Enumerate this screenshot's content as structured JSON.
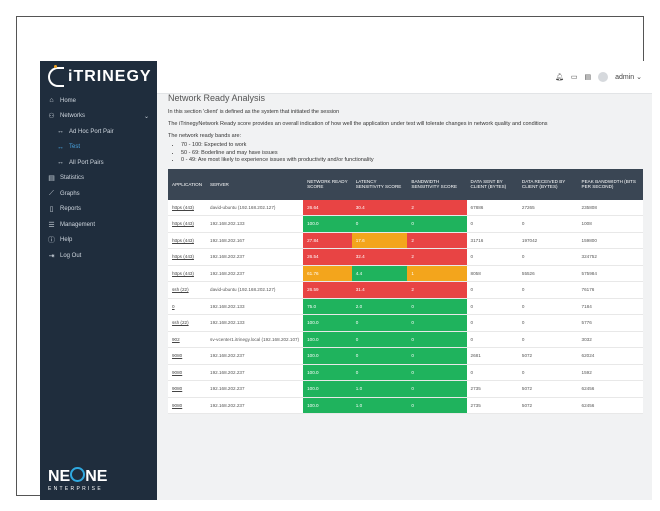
{
  "brand": {
    "logo_text": "iTRINEGY",
    "footer_big": "NE ONE",
    "footer_big_a": "NE",
    "footer_big_b": "NE",
    "footer_small": "ENTERPRISE"
  },
  "colors": {
    "sidebar": "#1f2d3d",
    "header": "#3a4654",
    "red": "#e84444",
    "green": "#1fb35d",
    "orange": "#f3a51c",
    "active": "#4aa3df"
  },
  "nav": [
    {
      "label": "Home",
      "icon": "home-icon",
      "glyph": "⌂"
    },
    {
      "label": "Networks",
      "icon": "networks-icon",
      "glyph": "⚇",
      "chevron": "⌄"
    },
    {
      "label": "Ad Hoc Port Pair",
      "icon": "arrows-icon",
      "glyph": "↔",
      "sub": true
    },
    {
      "label": "Test",
      "icon": "arrows-icon",
      "glyph": "↔",
      "sub": true,
      "active": true
    },
    {
      "label": "All Port Pairs",
      "icon": "arrows-icon",
      "glyph": "↔",
      "sub": true
    },
    {
      "label": "Statistics",
      "icon": "statistics-icon",
      "glyph": "▤"
    },
    {
      "label": "Graphs",
      "icon": "graphs-icon",
      "glyph": "⟋"
    },
    {
      "label": "Reports",
      "icon": "reports-icon",
      "glyph": "▯"
    },
    {
      "label": "Management",
      "icon": "management-icon",
      "glyph": "☰"
    },
    {
      "label": "Help",
      "icon": "help-icon",
      "glyph": "ⓘ"
    },
    {
      "label": "Log Out",
      "icon": "logout-icon",
      "glyph": "⇥"
    }
  ],
  "topbar": {
    "user": "admin",
    "chevron": "⌄"
  },
  "page": {
    "title": "Network Ready Analysis",
    "p1": "In this section 'client' is defined as the system that initiated the session",
    "p2": "The iTrinegyNetwork Ready score provides an overall indication of how well the application under test will tolerate changes in network quality and conditions",
    "p3": "The network ready bands are:",
    "bands": [
      "70 - 100: Expected to work",
      "50 - 69: Boderline and may have issues",
      "0 - 49: Are most likely to experience issues with productivity and/or functionality"
    ]
  },
  "table": {
    "headers": [
      "APPLICATION",
      "SERVER",
      "NETWORK READY SCORE",
      "LATENCY SENSITIVITY SCORE",
      "BANDWIDTH SENSITIVITY SCORE",
      "DATA SENT BY CLIENT (BYTES)",
      "DATA RECEIVED BY CLIENT (BYTES)",
      "PEAK BANDWIDTH (BITS PER SECOND)"
    ],
    "rows": [
      {
        "app": "https (443)",
        "server": "david-ubuntu (192.168.202.127)",
        "nrs": "26.64",
        "nrs_c": "red",
        "lat": "30.4",
        "lat_c": "red",
        "bw": "2",
        "bw_c": "red",
        "sent": "67886",
        "recv": "27265",
        "peak": "235808"
      },
      {
        "app": "https (443)",
        "server": "192.168.202.133",
        "nrs": "100.0",
        "nrs_c": "green",
        "lat": "0",
        "lat_c": "green",
        "bw": "0",
        "bw_c": "green",
        "sent": "0",
        "recv": "0",
        "peak": "1008"
      },
      {
        "app": "https (443)",
        "server": "192.168.202.167",
        "nrs": "27.84",
        "nrs_c": "red",
        "lat": "17.6",
        "lat_c": "orange",
        "bw": "2",
        "bw_c": "red",
        "sent": "31716",
        "recv": "197042",
        "peak": "159800"
      },
      {
        "app": "https (443)",
        "server": "192.168.202.237",
        "nrs": "26.54",
        "nrs_c": "red",
        "lat": "32.4",
        "lat_c": "red",
        "bw": "2",
        "bw_c": "red",
        "sent": "0",
        "recv": "0",
        "peak": "324752"
      },
      {
        "app": "https (443)",
        "server": "192.168.202.237",
        "nrs": "61.76",
        "nrs_c": "orange",
        "lat": "4.4",
        "lat_c": "green",
        "bw": "1",
        "bw_c": "orange",
        "sent": "8058",
        "recv": "55526",
        "peak": "575984"
      },
      {
        "app": "ssh (22)",
        "server": "david-ubuntu (192.168.202.127)",
        "nrs": "26.59",
        "nrs_c": "red",
        "lat": "31.4",
        "lat_c": "red",
        "bw": "2",
        "bw_c": "red",
        "sent": "0",
        "recv": "0",
        "peak": "76176"
      },
      {
        "app": "0",
        "server": "192.168.202.133",
        "nrs": "75.0",
        "nrs_c": "green",
        "lat": "2.0",
        "lat_c": "green",
        "bw": "0",
        "bw_c": "green",
        "sent": "0",
        "recv": "0",
        "peak": "7184"
      },
      {
        "app": "ssh (22)",
        "server": "192.168.202.133",
        "nrs": "100.0",
        "nrs_c": "green",
        "lat": "0",
        "lat_c": "green",
        "bw": "0",
        "bw_c": "green",
        "sent": "0",
        "recv": "0",
        "peak": "5776"
      },
      {
        "app": "902",
        "server": "sv-vcenter1.itrinegy.local (192.168.202.107)",
        "nrs": "100.0",
        "nrs_c": "green",
        "lat": "0",
        "lat_c": "green",
        "bw": "0",
        "bw_c": "green",
        "sent": "0",
        "recv": "0",
        "peak": "3032"
      },
      {
        "app": "9080",
        "server": "192.168.202.237",
        "nrs": "100.0",
        "nrs_c": "green",
        "lat": "0",
        "lat_c": "green",
        "bw": "0",
        "bw_c": "green",
        "sent": "2681",
        "recv": "5072",
        "peak": "62024"
      },
      {
        "app": "9080",
        "server": "192.168.202.237",
        "nrs": "100.0",
        "nrs_c": "green",
        "lat": "0",
        "lat_c": "green",
        "bw": "0",
        "bw_c": "green",
        "sent": "0",
        "recv": "0",
        "peak": "1592"
      },
      {
        "app": "9080",
        "server": "192.168.202.237",
        "nrs": "100.0",
        "nrs_c": "green",
        "lat": "1.0",
        "lat_c": "green",
        "bw": "0",
        "bw_c": "green",
        "sent": "2735",
        "recv": "5072",
        "peak": "62456"
      },
      {
        "app": "9080",
        "server": "192.168.202.237",
        "nrs": "100.0",
        "nrs_c": "green",
        "lat": "1.0",
        "lat_c": "green",
        "bw": "0",
        "bw_c": "green",
        "sent": "2735",
        "recv": "5072",
        "peak": "62456"
      }
    ]
  }
}
